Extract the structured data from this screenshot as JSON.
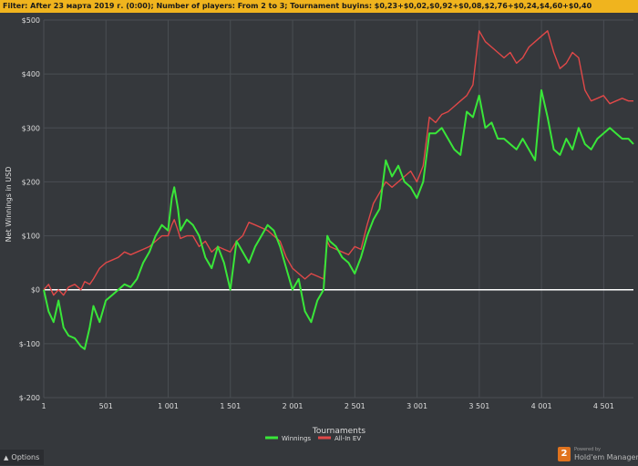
{
  "filter": {
    "label": "Filter:",
    "text": "After 23 марта 2019 г. (0:00); Number of players: From 2 to 3; Tournament buyins: $0,23+$0,02,$0,92+$0,08,$2,76+$0,24,$4,60+$0,40"
  },
  "options": {
    "label": "Options",
    "icon": "triangle-up-icon"
  },
  "brand": {
    "powered_by": "Powered by",
    "name": "Hold'em Manager",
    "badge": "2"
  },
  "colors": {
    "background": "#35383c",
    "filter_bar": "#f0b41e",
    "winnings": "#39e639",
    "allin_ev": "#e04848",
    "zero_line": "#ffffff",
    "grid": "#4a4e53"
  },
  "chart_data": {
    "type": "line",
    "xlabel": "Tournaments",
    "ylabel": "Net Winnings in USD",
    "xlim": [
      1,
      4740
    ],
    "ylim": [
      -200,
      500
    ],
    "x_ticks": [
      1,
      501,
      1001,
      1501,
      2001,
      2501,
      3001,
      3501,
      4001,
      4501
    ],
    "x_tick_labels": [
      "1",
      "501",
      "1 001",
      "1 501",
      "2 001",
      "2 501",
      "3 001",
      "3 501",
      "4 001",
      "4 501"
    ],
    "y_ticks": [
      -200,
      -100,
      0,
      100,
      200,
      300,
      400,
      500
    ],
    "y_tick_labels": [
      "$-200",
      "$-100",
      "$0",
      "$100",
      "$200",
      "$300",
      "$400",
      "$500"
    ],
    "grid": true,
    "legend_position": "bottom-center",
    "series": [
      {
        "name": "Winnings",
        "color": "#39e639",
        "x": [
          1,
          40,
          80,
          120,
          160,
          200,
          250,
          300,
          330,
          370,
          400,
          450,
          500,
          550,
          600,
          650,
          700,
          750,
          800,
          850,
          900,
          950,
          1000,
          1030,
          1050,
          1080,
          1100,
          1150,
          1200,
          1250,
          1300,
          1350,
          1400,
          1450,
          1500,
          1550,
          1600,
          1650,
          1700,
          1750,
          1800,
          1850,
          1900,
          1950,
          2000,
          2050,
          2100,
          2150,
          2200,
          2250,
          2280,
          2300,
          2350,
          2400,
          2450,
          2500,
          2550,
          2600,
          2650,
          2700,
          2750,
          2800,
          2850,
          2900,
          2950,
          3000,
          3050,
          3100,
          3150,
          3200,
          3250,
          3300,
          3350,
          3400,
          3450,
          3500,
          3550,
          3600,
          3650,
          3700,
          3750,
          3800,
          3850,
          3900,
          3950,
          4000,
          4050,
          4100,
          4150,
          4200,
          4250,
          4300,
          4350,
          4400,
          4450,
          4500,
          4550,
          4600,
          4650,
          4700,
          4740
        ],
        "y": [
          0,
          -40,
          -60,
          -20,
          -70,
          -85,
          -90,
          -105,
          -110,
          -70,
          -30,
          -60,
          -20,
          -10,
          0,
          10,
          5,
          20,
          50,
          70,
          100,
          120,
          110,
          170,
          190,
          150,
          110,
          130,
          120,
          100,
          60,
          40,
          80,
          50,
          0,
          90,
          70,
          50,
          80,
          100,
          120,
          110,
          80,
          40,
          0,
          20,
          -40,
          -60,
          -20,
          0,
          100,
          90,
          80,
          60,
          50,
          30,
          60,
          100,
          130,
          150,
          240,
          210,
          230,
          200,
          190,
          170,
          200,
          290,
          290,
          300,
          280,
          260,
          250,
          330,
          320,
          360,
          300,
          310,
          280,
          280,
          270,
          260,
          280,
          260,
          240,
          370,
          320,
          260,
          250,
          280,
          260,
          300,
          270,
          260,
          280,
          290,
          300,
          290,
          280,
          280,
          270
        ]
      },
      {
        "name": "All-In EV",
        "color": "#e04848",
        "x": [
          1,
          40,
          80,
          120,
          160,
          200,
          250,
          300,
          330,
          370,
          400,
          450,
          500,
          550,
          600,
          650,
          700,
          750,
          800,
          850,
          900,
          950,
          1000,
          1030,
          1050,
          1080,
          1100,
          1150,
          1200,
          1250,
          1300,
          1350,
          1400,
          1450,
          1500,
          1550,
          1600,
          1650,
          1700,
          1750,
          1800,
          1850,
          1900,
          1950,
          2000,
          2050,
          2100,
          2150,
          2200,
          2250,
          2280,
          2300,
          2350,
          2400,
          2450,
          2500,
          2550,
          2600,
          2650,
          2700,
          2750,
          2800,
          2850,
          2900,
          2950,
          3000,
          3050,
          3100,
          3150,
          3200,
          3250,
          3300,
          3350,
          3400,
          3450,
          3500,
          3550,
          3600,
          3650,
          3700,
          3750,
          3800,
          3850,
          3900,
          3950,
          4000,
          4050,
          4100,
          4150,
          4200,
          4250,
          4300,
          4350,
          4400,
          4450,
          4500,
          4550,
          4600,
          4650,
          4700,
          4740
        ],
        "y": [
          0,
          10,
          -10,
          0,
          -10,
          5,
          10,
          0,
          15,
          10,
          20,
          40,
          50,
          55,
          60,
          70,
          65,
          70,
          75,
          80,
          90,
          100,
          100,
          120,
          130,
          110,
          95,
          100,
          100,
          80,
          90,
          70,
          80,
          75,
          70,
          90,
          100,
          125,
          120,
          115,
          110,
          100,
          90,
          60,
          40,
          30,
          20,
          30,
          25,
          20,
          90,
          80,
          75,
          70,
          65,
          80,
          75,
          120,
          160,
          180,
          200,
          190,
          200,
          210,
          220,
          200,
          230,
          320,
          310,
          325,
          330,
          340,
          350,
          360,
          380,
          480,
          460,
          450,
          440,
          430,
          440,
          420,
          430,
          450,
          460,
          470,
          480,
          440,
          410,
          420,
          440,
          430,
          370,
          350,
          355,
          360,
          345,
          350,
          355,
          350,
          350
        ]
      }
    ]
  }
}
